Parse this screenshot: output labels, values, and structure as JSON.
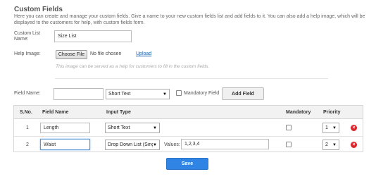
{
  "header": {
    "title": "Custom Fields",
    "intro": "Here you can create and manage your custom fields. Give a name to your new custom fields list and add fields to it. You can also add a help image, which will be displayed to the customers for help, with custom fields form."
  },
  "list_name": {
    "label": "Custom List Name:",
    "value": "Size List"
  },
  "help_image": {
    "label": "Help Image:",
    "choose_file": "Choose File",
    "no_file": "No file chosen",
    "upload": "Upload",
    "hint": "This image can be served as a help for customers to fill in the custom fields."
  },
  "add_field": {
    "label": "Field Name:",
    "name_value": "",
    "type_value": "Short Text",
    "mandatory_label": "Mandatory Field",
    "button": "Add Field"
  },
  "table": {
    "headers": {
      "sno": "S.No.",
      "field_name": "Input Type",
      "name": "Field Name",
      "mandatory": "Mandatory",
      "priority": "Priority"
    },
    "rows": [
      {
        "sno": "1",
        "name": "Length",
        "type": "Short Text",
        "values_label": "",
        "values": "",
        "priority": "1"
      },
      {
        "sno": "2",
        "name": "Waist",
        "type": "Drop Down List (Sing",
        "values_label": "Values:",
        "values": "1,2,3,4",
        "priority": "2"
      }
    ]
  },
  "actions": {
    "save": "Save"
  },
  "colors": {
    "save_bg": "#2f84e4",
    "delete_icon": "#d9262c",
    "link": "#1a5fa8"
  }
}
